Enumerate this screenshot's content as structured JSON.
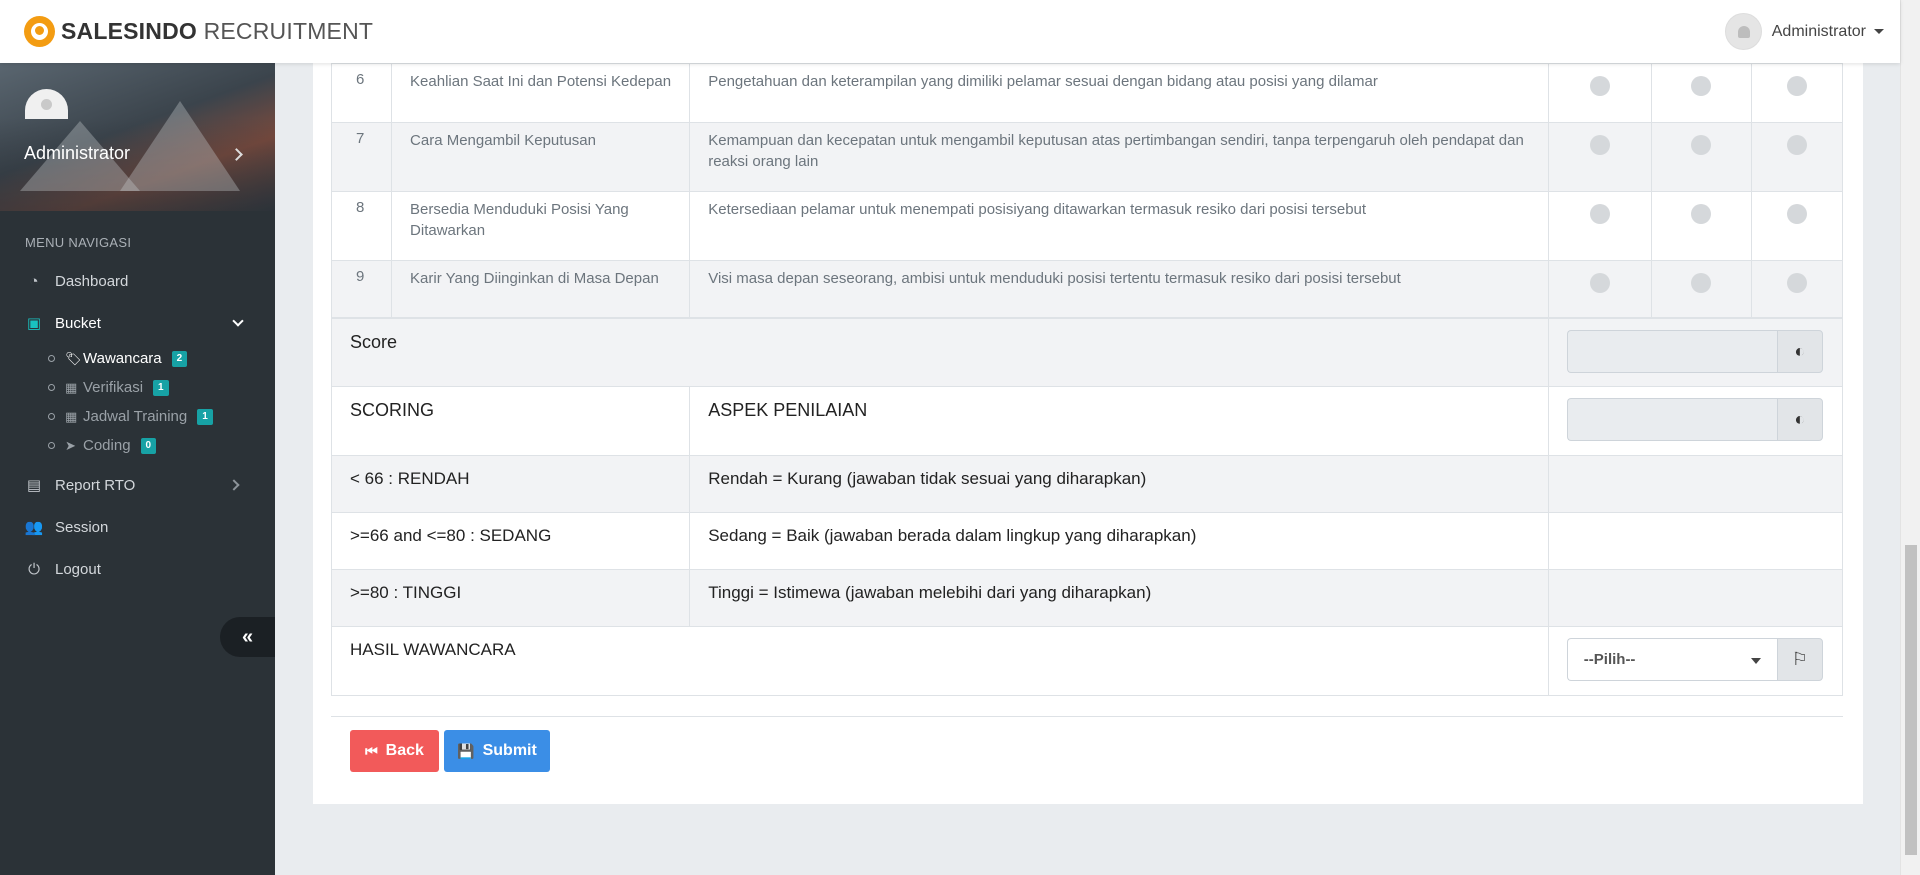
{
  "header": {
    "brand_bold": "SALESINDO",
    "brand_light": "RECRUITMENT",
    "user_name": "Administrator"
  },
  "sidebar": {
    "user_name": "Administrator",
    "menu_header": "MENU NAVIGASI",
    "items": [
      {
        "label": "Dashboard",
        "icon": "tachometer-icon"
      },
      {
        "label": "Bucket",
        "icon": "bucket-icon"
      },
      {
        "label": "Report RTO",
        "icon": "file-icon"
      },
      {
        "label": "Session",
        "icon": "users-icon"
      },
      {
        "label": "Logout",
        "icon": "power-icon"
      }
    ],
    "subitems": [
      {
        "label": "Wawancara",
        "icon": "tags-icon",
        "badge": "2"
      },
      {
        "label": "Verifikasi",
        "icon": "calendar-check-icon",
        "badge": "1"
      },
      {
        "label": "Jadwal Training",
        "icon": "calendar-icon",
        "badge": "1"
      },
      {
        "label": "Coding",
        "icon": "paper-plane-icon",
        "badge": "0"
      }
    ],
    "collapse_glyph": "«"
  },
  "questions": [
    {
      "num": "6",
      "aspect": "Keahlian Saat Ini dan Potensi Kedepan",
      "desc": "Pengetahuan dan keterampilan yang dimiliki pelamar sesuai dengan bidang atau posisi yang dilamar"
    },
    {
      "num": "7",
      "aspect": "Cara Mengambil Keputusan",
      "desc": "Kemampuan dan kecepatan untuk mengambil keputusan atas pertimbangan sendiri, tanpa terpengaruh oleh pendapat dan reaksi orang lain"
    },
    {
      "num": "8",
      "aspect": "Bersedia Menduduki Posisi Yang Ditawarkan",
      "desc": "Ketersediaan pelamar untuk menempati posisiyang ditawarkan termasuk resiko dari posisi tersebut"
    },
    {
      "num": "9",
      "aspect": "Karir Yang Diinginkan di Masa Depan",
      "desc": "Visi masa depan seseorang, ambisi untuk menduduki posisi tertentu termasuk resiko dari posisi tersebut"
    }
  ],
  "score_label": "Score",
  "scoring": {
    "col1": "SCORING",
    "col2": "ASPEK PENILAIAN",
    "rows": [
      {
        "range": "< 66 : RENDAH",
        "meaning": "Rendah = Kurang (jawaban tidak sesuai yang diharapkan)"
      },
      {
        "range": ">=66 and <=80 : SEDANG",
        "meaning": "Sedang = Baik (jawaban berada dalam lingkup yang diharapkan)"
      },
      {
        "range": ">=80 : TINGGI",
        "meaning": "Tinggi = Istimewa (jawaban melebihi dari yang diharapkan)"
      }
    ]
  },
  "hasil": {
    "label": "HASIL WAWANCARA",
    "selected": "--Pilih--"
  },
  "buttons": {
    "back": "Back",
    "submit": "Submit"
  }
}
